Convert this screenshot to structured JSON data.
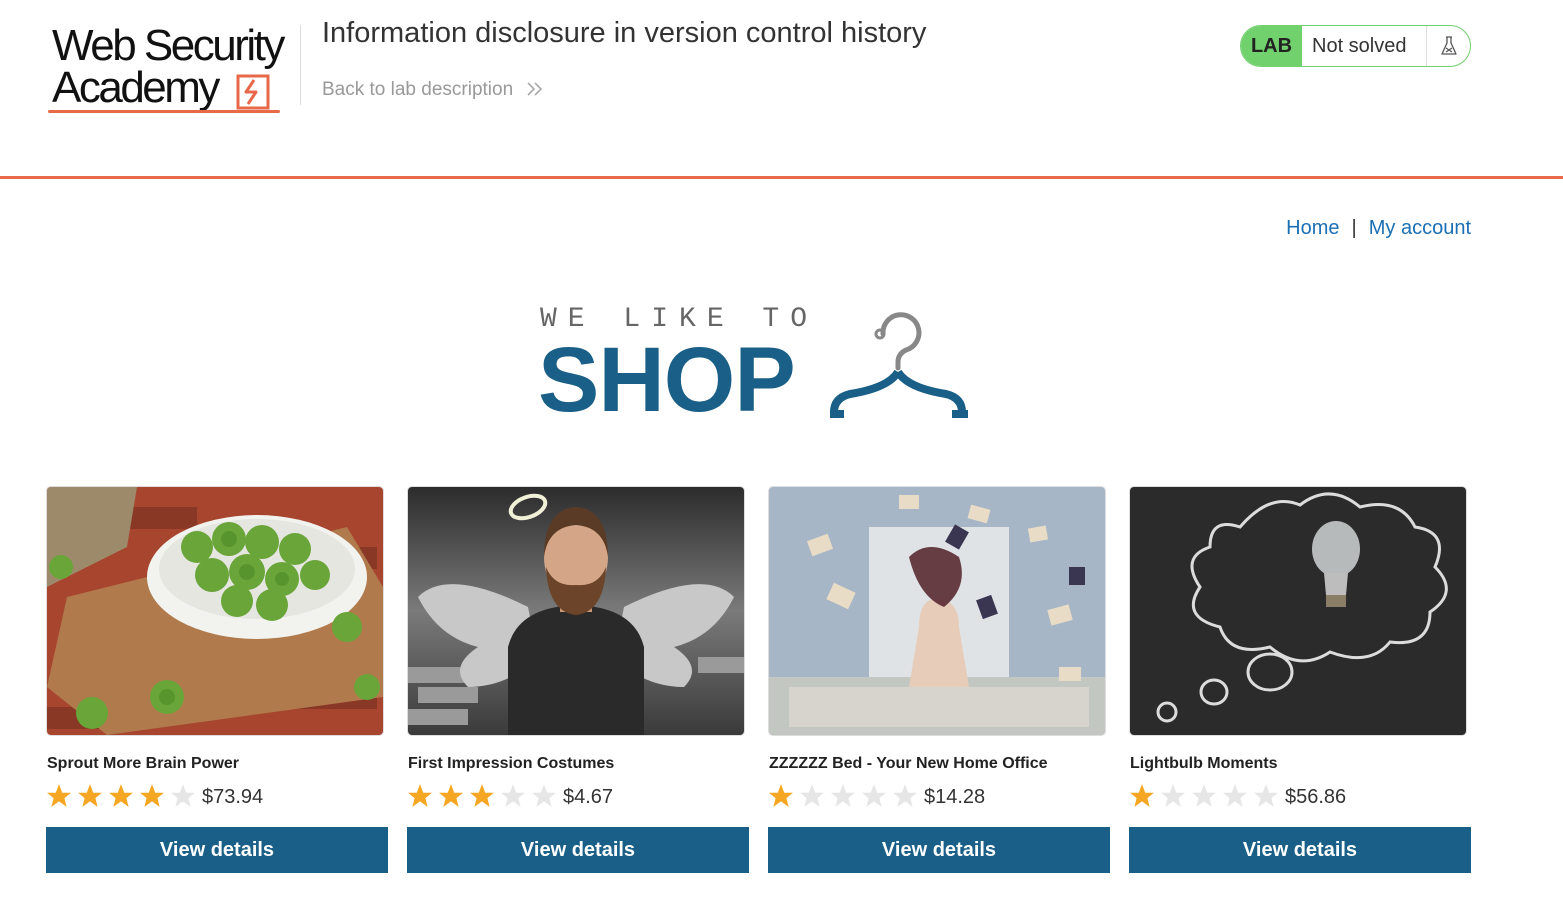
{
  "header": {
    "logo_line1": "Web Security",
    "logo_line2": "Academy",
    "lab_title": "Information disclosure in version control history",
    "back_link": "Back to lab description",
    "lab_badge": "LAB",
    "lab_status": "Not solved"
  },
  "nav": {
    "home": "Home",
    "separator": "|",
    "account": "My account"
  },
  "banner": {
    "we_like_to": "WE LIKE TO",
    "shop": "SHOP"
  },
  "products": [
    {
      "name": "Sprout More Brain Power",
      "rating": 4,
      "price": "$73.94",
      "button": "View details"
    },
    {
      "name": "First Impression Costumes",
      "rating": 3,
      "price": "$4.67",
      "button": "View details"
    },
    {
      "name": "ZZZZZZ Bed - Your New Home Office",
      "rating": 1,
      "price": "$14.28",
      "button": "View details"
    },
    {
      "name": "Lightbulb Moments",
      "rating": 1,
      "price": "$56.86",
      "button": "View details"
    }
  ],
  "colors": {
    "accent_orange": "#e8684a",
    "brand_blue": "#1a5f87",
    "link_blue": "#1b6fb5",
    "lab_green": "#70d16d",
    "star_filled": "#f5a623",
    "star_empty": "#e6e6e6"
  }
}
